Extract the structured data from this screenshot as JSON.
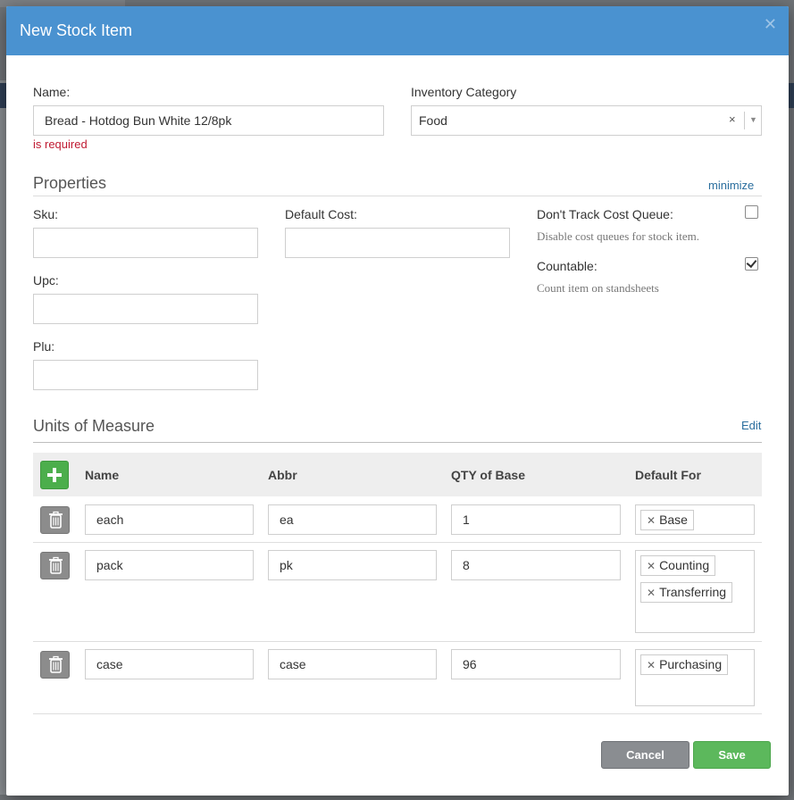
{
  "dialog": {
    "title": "New Stock Item"
  },
  "name_field": {
    "label": "Name:",
    "value": "Bread - Hotdog Bun White 12/8pk",
    "error": "is required"
  },
  "category_field": {
    "label": "Inventory Category",
    "value": "Food",
    "clear_glyph": "×",
    "arrow_glyph": "▼"
  },
  "properties": {
    "title": "Properties",
    "minimize_label": "minimize",
    "sku_label": "Sku:",
    "sku_value": "",
    "default_cost_label": "Default Cost:",
    "default_cost_value": "",
    "upc_label": "Upc:",
    "upc_value": "",
    "plu_label": "Plu:",
    "plu_value": "",
    "dont_track": {
      "label": "Don't Track Cost Queue:",
      "help": "Disable cost queues for stock item.",
      "checked": false
    },
    "countable": {
      "label": "Countable:",
      "help": "Count item on standsheets",
      "checked": true
    }
  },
  "uom": {
    "title": "Units of Measure",
    "edit_label": "Edit",
    "headers": {
      "name": "Name",
      "abbr": "Abbr",
      "qty": "QTY of Base",
      "default_for": "Default For"
    },
    "rows": [
      {
        "name": "each",
        "abbr": "ea",
        "qty": "1",
        "tags": [
          "Base"
        ]
      },
      {
        "name": "pack",
        "abbr": "pk",
        "qty": "8",
        "tags": [
          "Counting",
          "Transferring"
        ]
      },
      {
        "name": "case",
        "abbr": "case",
        "qty": "96",
        "tags": [
          "Purchasing"
        ]
      }
    ]
  },
  "footer": {
    "cancel_label": "Cancel",
    "save_label": "Save"
  },
  "icons": {
    "close": "close-icon",
    "add": "plus-icon",
    "delete": "trash-icon",
    "tag_remove": "x-icon",
    "clear": "clear-icon",
    "dropdown": "chevron-down-icon"
  },
  "colors": {
    "header": "#4a92d0",
    "error": "#c01a32",
    "link": "#2a6e9e",
    "add_button": "#4cae4c",
    "save_button": "#5cb85c",
    "cancel_button": "#8a8d91"
  }
}
